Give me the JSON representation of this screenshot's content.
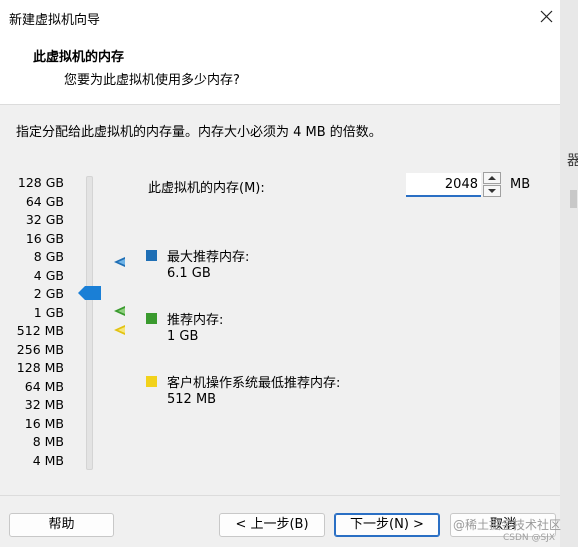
{
  "window": {
    "title": "新建虚拟机向导"
  },
  "header": {
    "title": "此虚拟机的内存",
    "subtitle": "您要为此虚拟机使用多少内存?"
  },
  "instruction": "指定分配给此虚拟机的内存量。内存大小必须为 4 MB 的倍数。",
  "memory_scale": [
    "128 GB",
    "64 GB",
    "32 GB",
    "16 GB",
    "8 GB",
    "4 GB",
    "2 GB",
    "1 GB",
    "512 MB",
    "256 MB",
    "128 MB",
    "64 MB",
    "32 MB",
    "16 MB",
    "8 MB",
    "4 MB"
  ],
  "memory": {
    "label": "此虚拟机的内存(M):",
    "value": "2048",
    "unit": "MB",
    "selected_scale": "2 GB"
  },
  "legend": [
    {
      "title": "最大推荐内存:",
      "value": "6.1 GB",
      "color": "#1f6fb5"
    },
    {
      "title": "推荐内存:",
      "value": "1 GB",
      "color": "#3a9a2e"
    },
    {
      "title": "客户机操作系统最低推荐内存:",
      "value": "512 MB",
      "color": "#f2d21b"
    }
  ],
  "colors": {
    "accent": "#2a6fc4",
    "slider_thumb": "#1a7fd6"
  },
  "side_fragment": "器",
  "footer": {
    "help": "帮助",
    "back": "< 上一步(B)",
    "next": "下一步(N) >",
    "cancel": "取消"
  },
  "watermark": {
    "line1": "@稀土掘金技术社区",
    "line2": "CSDN @SJX"
  }
}
